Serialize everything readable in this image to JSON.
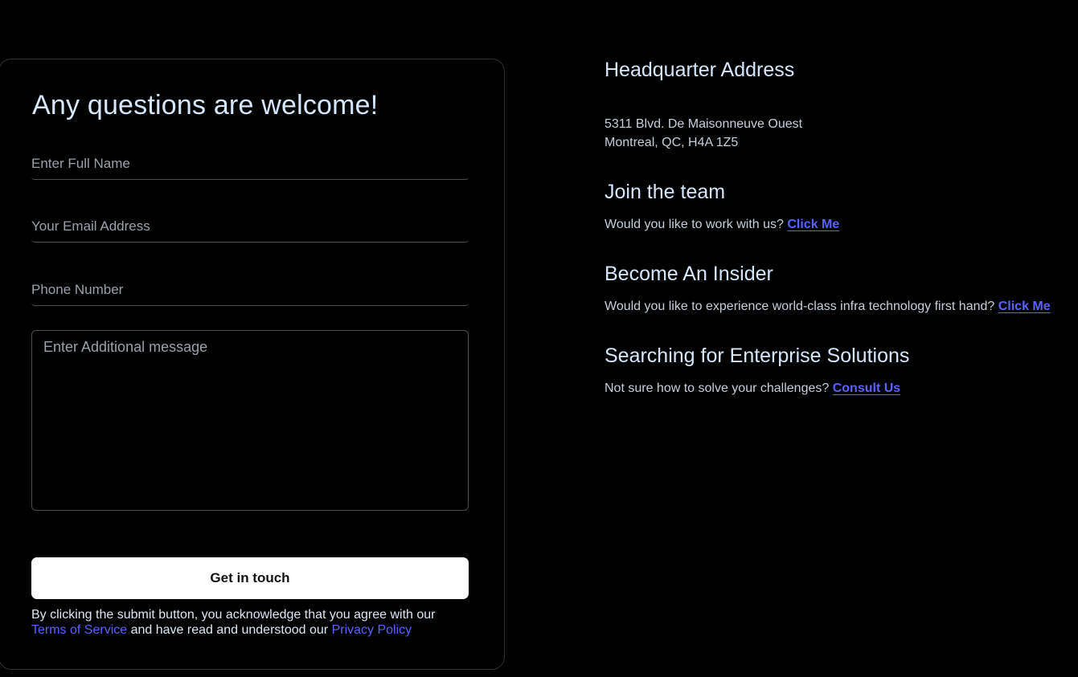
{
  "form": {
    "title": "Any questions are welcome!",
    "full_name_placeholder": "Enter Full Name",
    "email_placeholder": "Your Email Address",
    "phone_placeholder": "Phone Number",
    "message_placeholder": "Enter Additional message",
    "submit_label": "Get in touch",
    "legal_prefix": "By clicking the submit button, you acknowledge that you agree with our",
    "terms_label": "Terms of Service",
    "legal_middle": " and have read and understood our ",
    "privacy_label": "Privacy Policy"
  },
  "info": {
    "hq_title": "Headquarter Address",
    "hq_line1": "5311 Blvd. De Maisonneuve Ouest",
    "hq_line2": "Montreal, QC, H4A 1Z5",
    "join_title": "Join the team",
    "join_text": "Would you like to work with us? ",
    "join_link": "Click Me",
    "insider_title": "Become An Insider",
    "insider_text": "Would you like to experience world-class infra technology first hand? ",
    "insider_link": "Click Me",
    "enterprise_title": "Searching for Enterprise Solutions",
    "enterprise_text": "Not sure how to solve your challenges? ",
    "enterprise_link": "Consult Us"
  },
  "colors": {
    "background": "#000000",
    "heading": "#d6e6fb",
    "link": "#5b62ff",
    "button_bg": "#ffffff"
  }
}
